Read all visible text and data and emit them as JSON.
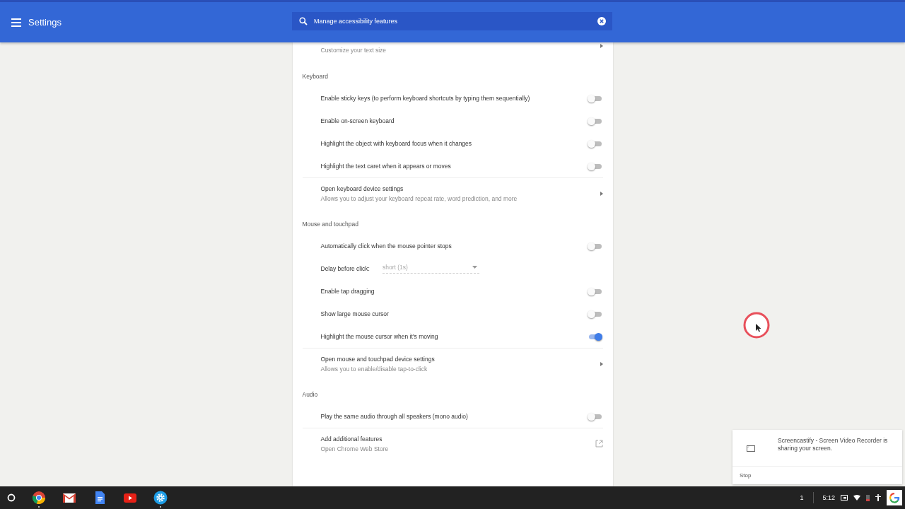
{
  "header": {
    "title": "Settings",
    "search": {
      "value": "Manage accessibility features"
    }
  },
  "top_item": {
    "subtitle": "Customize your text size"
  },
  "sections": [
    {
      "title": "Keyboard",
      "items": [
        {
          "kind": "toggle",
          "label": "Enable sticky keys (to perform keyboard shortcuts by typing them sequentially)",
          "on": false
        },
        {
          "kind": "toggle",
          "label": "Enable on-screen keyboard",
          "on": false
        },
        {
          "kind": "toggle",
          "label": "Highlight the object with keyboard focus when it changes",
          "on": false
        },
        {
          "kind": "toggle",
          "label": "Highlight the text caret when it appears or moves",
          "on": false
        },
        {
          "kind": "link",
          "label": "Open keyboard device settings",
          "subtitle": "Allows you to adjust your keyboard repeat rate, word prediction, and more",
          "external": false
        }
      ]
    },
    {
      "title": "Mouse and touchpad",
      "items": [
        {
          "kind": "toggle",
          "label": "Automatically click when the mouse pointer stops",
          "on": false
        },
        {
          "kind": "select",
          "label": "Delay before click:",
          "value": "short (1s)",
          "disabled": true
        },
        {
          "kind": "toggle",
          "label": "Enable tap dragging",
          "on": false
        },
        {
          "kind": "toggle",
          "label": "Show large mouse cursor",
          "on": false
        },
        {
          "kind": "toggle",
          "label": "Highlight the mouse cursor when it's moving",
          "on": true
        },
        {
          "kind": "link",
          "label": "Open mouse and touchpad device settings",
          "subtitle": "Allows you to enable/disable tap-to-click",
          "external": false
        }
      ]
    },
    {
      "title": "Audio",
      "items": [
        {
          "kind": "toggle",
          "label": "Play the same audio through all speakers (mono audio)",
          "on": false
        },
        {
          "kind": "link",
          "label": "Add additional features",
          "subtitle": "Open Chrome Web Store",
          "external": true
        }
      ]
    }
  ],
  "notification": {
    "message": "Screencastify - Screen Video Recorder is sharing your screen.",
    "action": "Stop"
  },
  "taskbar": {
    "apps": [
      {
        "kind": "chrome",
        "running": true
      },
      {
        "kind": "mail",
        "running": false
      },
      {
        "kind": "docs",
        "running": false
      },
      {
        "kind": "video",
        "running": false
      },
      {
        "kind": "settings",
        "running": true
      }
    ],
    "badge": "1",
    "time": "5:12"
  }
}
